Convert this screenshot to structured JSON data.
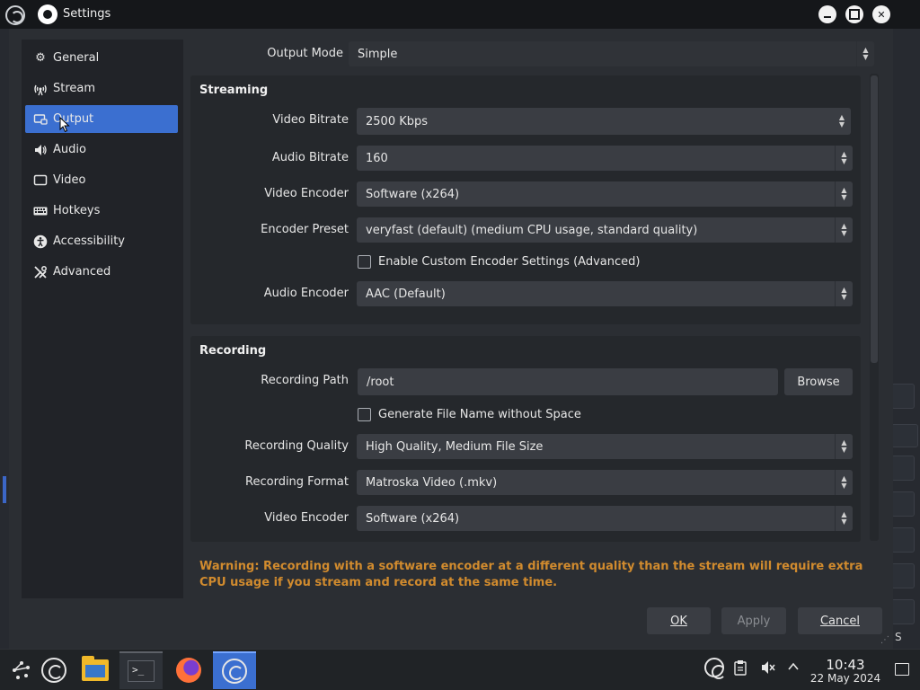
{
  "window": {
    "title": "Settings"
  },
  "sidebar": {
    "items": [
      {
        "label": "General",
        "icon": "gear-icon",
        "active": false
      },
      {
        "label": "Stream",
        "icon": "antenna-icon",
        "active": false
      },
      {
        "label": "Output",
        "icon": "output-icon",
        "active": true
      },
      {
        "label": "Audio",
        "icon": "speaker-icon",
        "active": false
      },
      {
        "label": "Video",
        "icon": "monitor-icon",
        "active": false
      },
      {
        "label": "Hotkeys",
        "icon": "keyboard-icon",
        "active": false
      },
      {
        "label": "Accessibility",
        "icon": "accessibility-icon",
        "active": false
      },
      {
        "label": "Advanced",
        "icon": "wrench-icon",
        "active": false
      }
    ]
  },
  "output_mode": {
    "label": "Output Mode",
    "value": "Simple"
  },
  "streaming": {
    "title": "Streaming",
    "video_bitrate": {
      "label": "Video Bitrate",
      "value": "2500 Kbps"
    },
    "audio_bitrate": {
      "label": "Audio Bitrate",
      "value": "160"
    },
    "video_encoder": {
      "label": "Video Encoder",
      "value": "Software (x264)"
    },
    "encoder_preset": {
      "label": "Encoder Preset",
      "value": "veryfast (default) (medium CPU usage, standard quality)"
    },
    "custom_settings": {
      "label": "Enable Custom Encoder Settings (Advanced)",
      "checked": false
    },
    "audio_encoder": {
      "label": "Audio Encoder",
      "value": "AAC (Default)"
    }
  },
  "recording": {
    "title": "Recording",
    "path": {
      "label": "Recording Path",
      "value": "/root"
    },
    "browse_label": "Browse",
    "no_space": {
      "label": "Generate File Name without Space",
      "checked": false
    },
    "quality": {
      "label": "Recording Quality",
      "value": "High Quality, Medium File Size"
    },
    "format": {
      "label": "Recording Format",
      "value": "Matroska Video (.mkv)"
    },
    "video_encoder": {
      "label": "Video Encoder",
      "value": "Software (x264)"
    }
  },
  "warning": "Warning: Recording with a software encoder at a different quality than the stream will require extra CPU usage if you stream and record at the same time.",
  "footer": {
    "ok": "OK",
    "apply": "Apply",
    "cancel": "Cancel"
  },
  "taskbar": {
    "clock_time": "10:43",
    "clock_date": "22 May 2024"
  },
  "background": {
    "peek_letter": "S"
  },
  "colors": {
    "accent": "#3b6fd0",
    "warning": "#d18b2e",
    "dialog_bg": "#2b2e33"
  }
}
